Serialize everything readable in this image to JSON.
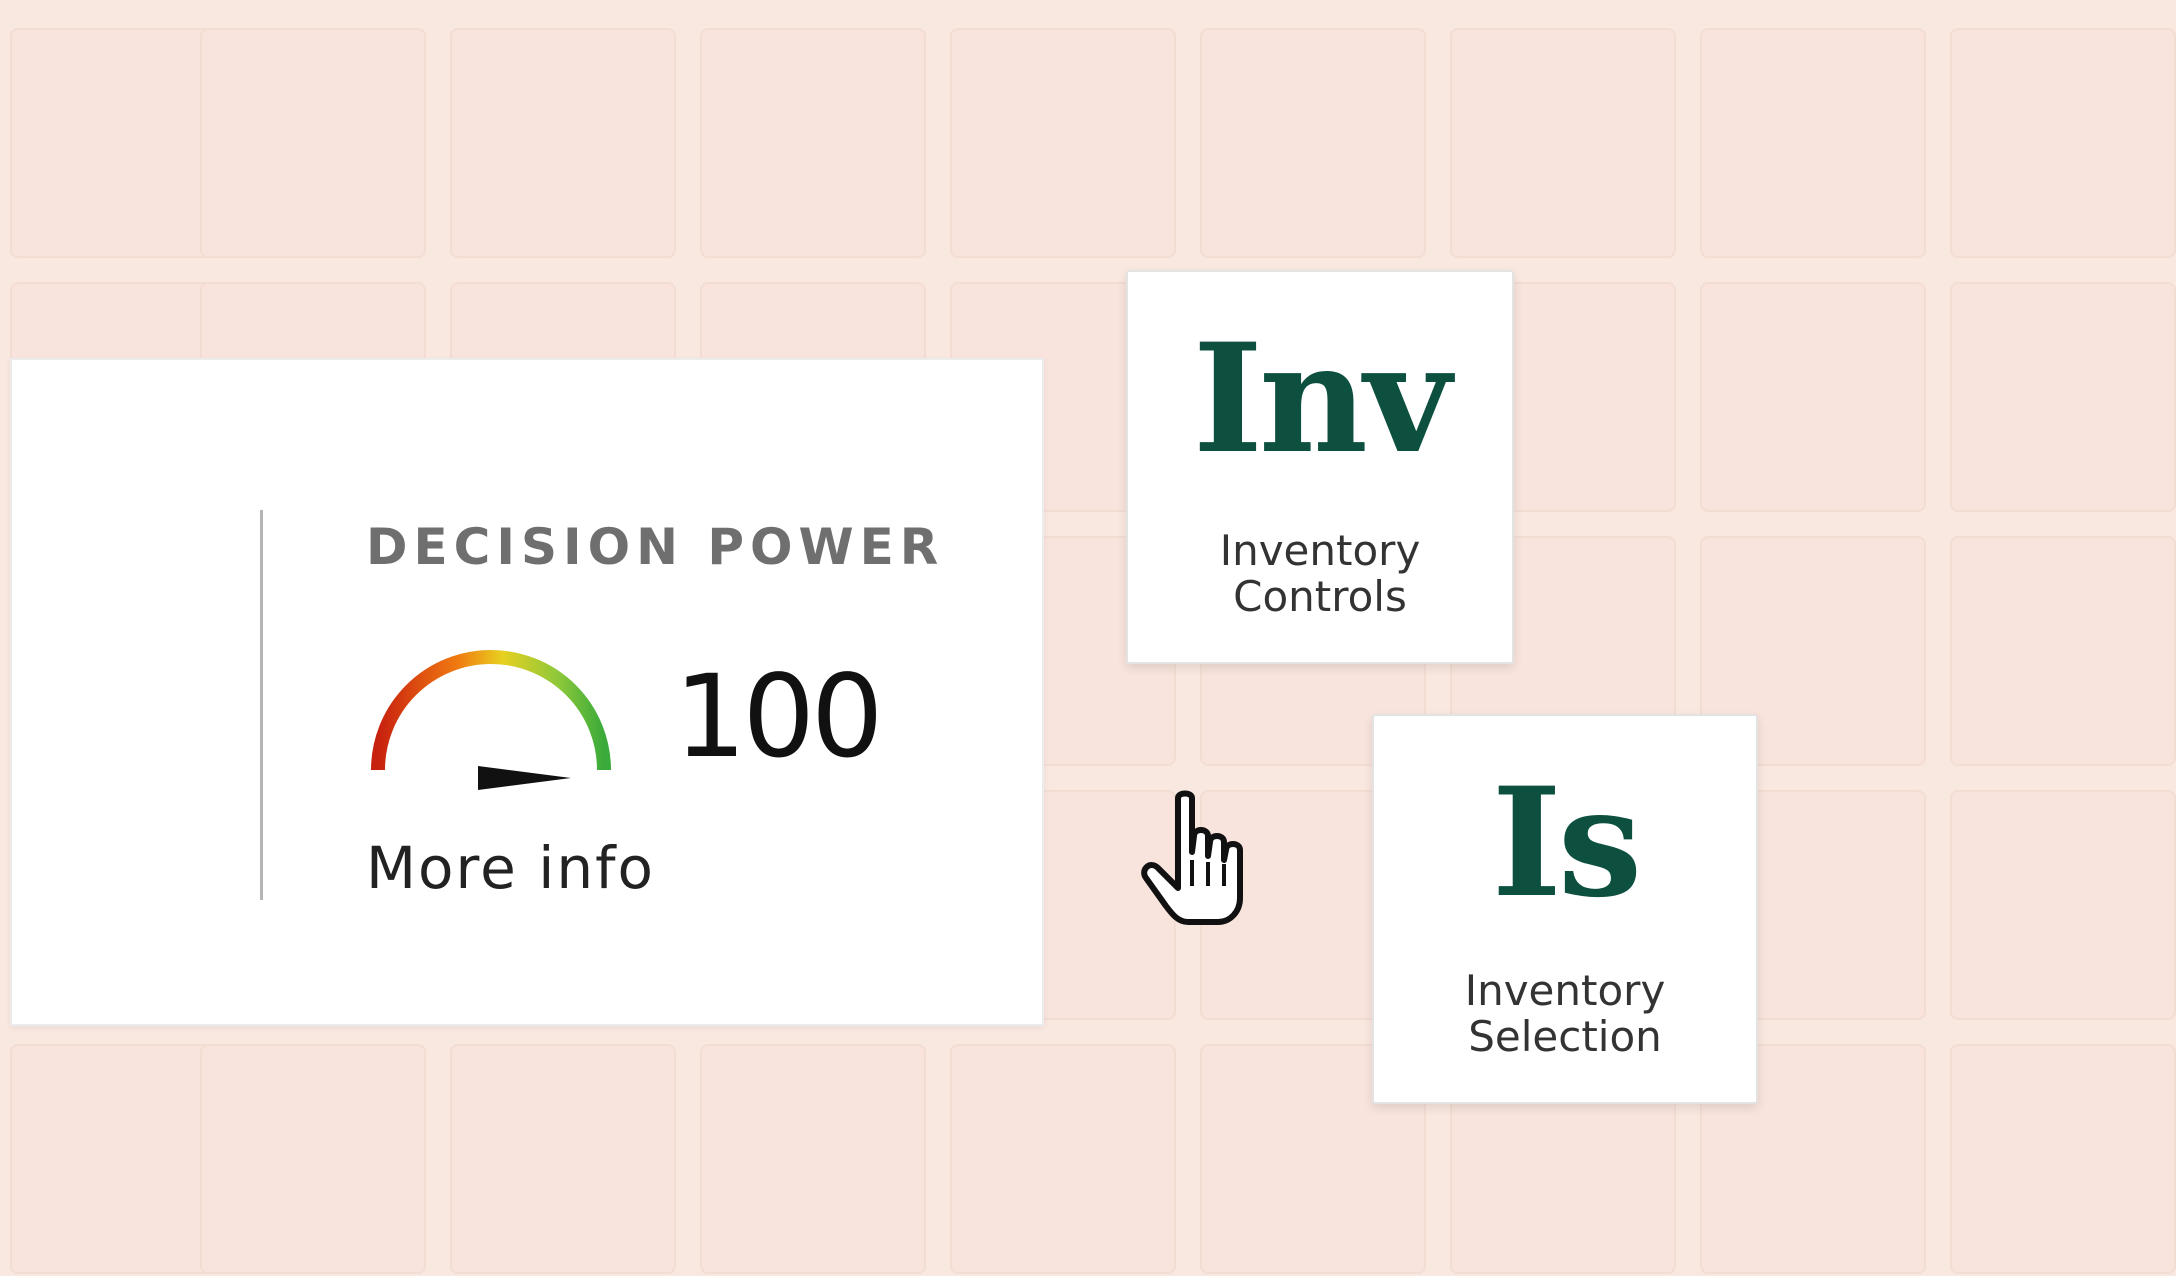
{
  "decision_power": {
    "title": "DECISION POWER",
    "value": "100",
    "gauge_level": 100,
    "more_info_label": "More info"
  },
  "tiles": [
    {
      "abbr": "Inv",
      "label": "Inventory Controls"
    },
    {
      "abbr": "Is",
      "label": "Inventory Selection"
    }
  ],
  "colors": {
    "background": "#f9e8e0",
    "tile_text": "#0d5040",
    "gauge_low": "#c8200f",
    "gauge_mid": "#e8d020",
    "gauge_high": "#3aaa3a"
  },
  "icons": {
    "cursor": "hand-pointer-icon",
    "gauge": "speedometer-icon"
  }
}
